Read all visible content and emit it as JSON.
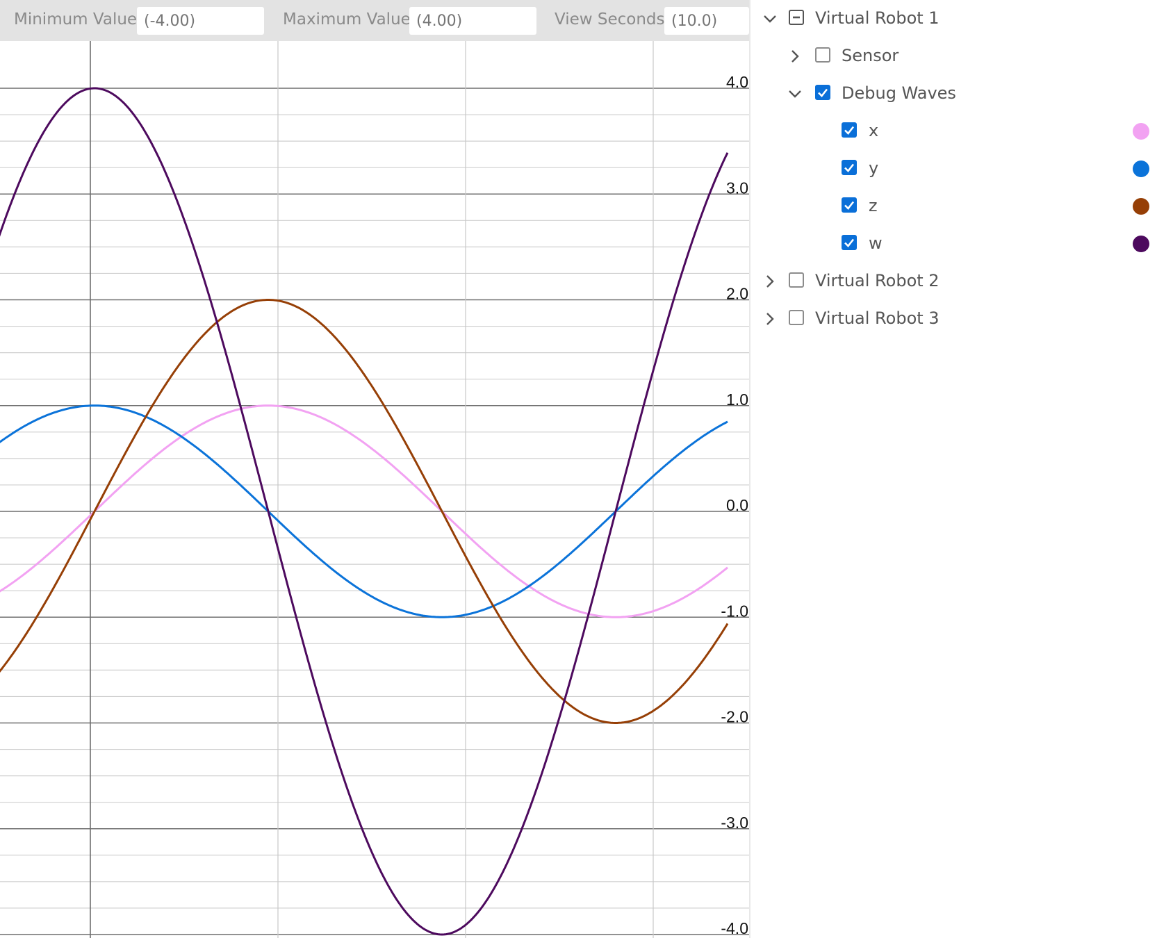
{
  "toolbar": {
    "min_label": "Minimum Value",
    "min_value": "(-4.00)",
    "max_label": "Maximum Value",
    "max_value": "(4.00)",
    "view_label": "View Seconds",
    "view_value": "(10.0)"
  },
  "tree": {
    "robot1": {
      "label": "Virtual Robot 1",
      "expanded": true,
      "checked": "partial"
    },
    "sensor": {
      "label": "Sensor",
      "expanded": false,
      "checked": false
    },
    "debug_waves": {
      "label": "Debug Waves",
      "expanded": true,
      "checked": true
    },
    "waves": [
      {
        "label": "x",
        "checked": true,
        "color": "#f2a2f2",
        "icon": "color-dot-icon"
      },
      {
        "label": "y",
        "checked": true,
        "color": "#0b73d9",
        "icon": "color-dot-icon"
      },
      {
        "label": "z",
        "checked": true,
        "color": "#963f06",
        "icon": "color-dot-icon"
      },
      {
        "label": "w",
        "checked": true,
        "color": "#4d0a5e",
        "icon": "color-dot-icon"
      }
    ],
    "robot2": {
      "label": "Virtual Robot 2",
      "expanded": false,
      "checked": false
    },
    "robot3": {
      "label": "Virtual Robot 3",
      "expanded": false,
      "checked": false
    }
  },
  "chart_data": {
    "type": "line",
    "ylim": [
      -4,
      4
    ],
    "view_seconds": 10,
    "y_ticks": [
      "4.0",
      "3.0",
      "2.0",
      "1.0",
      "0.0",
      "-1.0",
      "-2.0",
      "-3.0",
      "-4.0"
    ],
    "y_tick_values": [
      4,
      3,
      2,
      1,
      0,
      -1,
      -2,
      -3,
      -4
    ],
    "grid": true,
    "series": [
      {
        "name": "x",
        "color": "#f2a2f2",
        "amplitude": 1,
        "zero_at_x": 136,
        "period_x": 1000,
        "phase": 0,
        "x_start": -15,
        "x_end": 1049
      },
      {
        "name": "y",
        "color": "#0b73d9",
        "amplitude": 1,
        "zero_at_x": 136,
        "period_x": 1000,
        "phase": 90,
        "x_start": -15,
        "x_end": 1049
      },
      {
        "name": "z",
        "color": "#963f06",
        "amplitude": 2,
        "zero_at_x": 136,
        "period_x": 1000,
        "phase": 0,
        "x_start": -15,
        "x_end": 1049
      },
      {
        "name": "w",
        "color": "#4d0a5e",
        "amplitude": 4,
        "zero_at_x": 136,
        "period_x": 1000,
        "phase": 90,
        "x_start": -15,
        "x_end": 1049
      }
    ]
  }
}
